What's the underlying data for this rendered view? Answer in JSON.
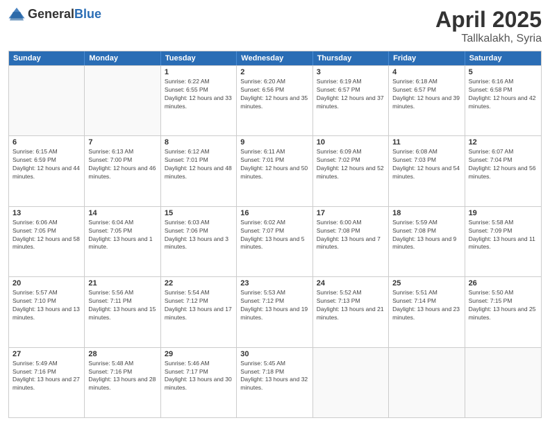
{
  "header": {
    "logo_general": "General",
    "logo_blue": "Blue",
    "title": "April 2025",
    "location": "Tallkalakh, Syria"
  },
  "calendar": {
    "weekdays": [
      "Sunday",
      "Monday",
      "Tuesday",
      "Wednesday",
      "Thursday",
      "Friday",
      "Saturday"
    ],
    "rows": [
      [
        {
          "day": "",
          "info": ""
        },
        {
          "day": "",
          "info": ""
        },
        {
          "day": "1",
          "info": "Sunrise: 6:22 AM\nSunset: 6:55 PM\nDaylight: 12 hours and 33 minutes."
        },
        {
          "day": "2",
          "info": "Sunrise: 6:20 AM\nSunset: 6:56 PM\nDaylight: 12 hours and 35 minutes."
        },
        {
          "day": "3",
          "info": "Sunrise: 6:19 AM\nSunset: 6:57 PM\nDaylight: 12 hours and 37 minutes."
        },
        {
          "day": "4",
          "info": "Sunrise: 6:18 AM\nSunset: 6:57 PM\nDaylight: 12 hours and 39 minutes."
        },
        {
          "day": "5",
          "info": "Sunrise: 6:16 AM\nSunset: 6:58 PM\nDaylight: 12 hours and 42 minutes."
        }
      ],
      [
        {
          "day": "6",
          "info": "Sunrise: 6:15 AM\nSunset: 6:59 PM\nDaylight: 12 hours and 44 minutes."
        },
        {
          "day": "7",
          "info": "Sunrise: 6:13 AM\nSunset: 7:00 PM\nDaylight: 12 hours and 46 minutes."
        },
        {
          "day": "8",
          "info": "Sunrise: 6:12 AM\nSunset: 7:01 PM\nDaylight: 12 hours and 48 minutes."
        },
        {
          "day": "9",
          "info": "Sunrise: 6:11 AM\nSunset: 7:01 PM\nDaylight: 12 hours and 50 minutes."
        },
        {
          "day": "10",
          "info": "Sunrise: 6:09 AM\nSunset: 7:02 PM\nDaylight: 12 hours and 52 minutes."
        },
        {
          "day": "11",
          "info": "Sunrise: 6:08 AM\nSunset: 7:03 PM\nDaylight: 12 hours and 54 minutes."
        },
        {
          "day": "12",
          "info": "Sunrise: 6:07 AM\nSunset: 7:04 PM\nDaylight: 12 hours and 56 minutes."
        }
      ],
      [
        {
          "day": "13",
          "info": "Sunrise: 6:06 AM\nSunset: 7:05 PM\nDaylight: 12 hours and 58 minutes."
        },
        {
          "day": "14",
          "info": "Sunrise: 6:04 AM\nSunset: 7:05 PM\nDaylight: 13 hours and 1 minute."
        },
        {
          "day": "15",
          "info": "Sunrise: 6:03 AM\nSunset: 7:06 PM\nDaylight: 13 hours and 3 minutes."
        },
        {
          "day": "16",
          "info": "Sunrise: 6:02 AM\nSunset: 7:07 PM\nDaylight: 13 hours and 5 minutes."
        },
        {
          "day": "17",
          "info": "Sunrise: 6:00 AM\nSunset: 7:08 PM\nDaylight: 13 hours and 7 minutes."
        },
        {
          "day": "18",
          "info": "Sunrise: 5:59 AM\nSunset: 7:08 PM\nDaylight: 13 hours and 9 minutes."
        },
        {
          "day": "19",
          "info": "Sunrise: 5:58 AM\nSunset: 7:09 PM\nDaylight: 13 hours and 11 minutes."
        }
      ],
      [
        {
          "day": "20",
          "info": "Sunrise: 5:57 AM\nSunset: 7:10 PM\nDaylight: 13 hours and 13 minutes."
        },
        {
          "day": "21",
          "info": "Sunrise: 5:56 AM\nSunset: 7:11 PM\nDaylight: 13 hours and 15 minutes."
        },
        {
          "day": "22",
          "info": "Sunrise: 5:54 AM\nSunset: 7:12 PM\nDaylight: 13 hours and 17 minutes."
        },
        {
          "day": "23",
          "info": "Sunrise: 5:53 AM\nSunset: 7:12 PM\nDaylight: 13 hours and 19 minutes."
        },
        {
          "day": "24",
          "info": "Sunrise: 5:52 AM\nSunset: 7:13 PM\nDaylight: 13 hours and 21 minutes."
        },
        {
          "day": "25",
          "info": "Sunrise: 5:51 AM\nSunset: 7:14 PM\nDaylight: 13 hours and 23 minutes."
        },
        {
          "day": "26",
          "info": "Sunrise: 5:50 AM\nSunset: 7:15 PM\nDaylight: 13 hours and 25 minutes."
        }
      ],
      [
        {
          "day": "27",
          "info": "Sunrise: 5:49 AM\nSunset: 7:16 PM\nDaylight: 13 hours and 27 minutes."
        },
        {
          "day": "28",
          "info": "Sunrise: 5:48 AM\nSunset: 7:16 PM\nDaylight: 13 hours and 28 minutes."
        },
        {
          "day": "29",
          "info": "Sunrise: 5:46 AM\nSunset: 7:17 PM\nDaylight: 13 hours and 30 minutes."
        },
        {
          "day": "30",
          "info": "Sunrise: 5:45 AM\nSunset: 7:18 PM\nDaylight: 13 hours and 32 minutes."
        },
        {
          "day": "",
          "info": ""
        },
        {
          "day": "",
          "info": ""
        },
        {
          "day": "",
          "info": ""
        }
      ]
    ]
  }
}
